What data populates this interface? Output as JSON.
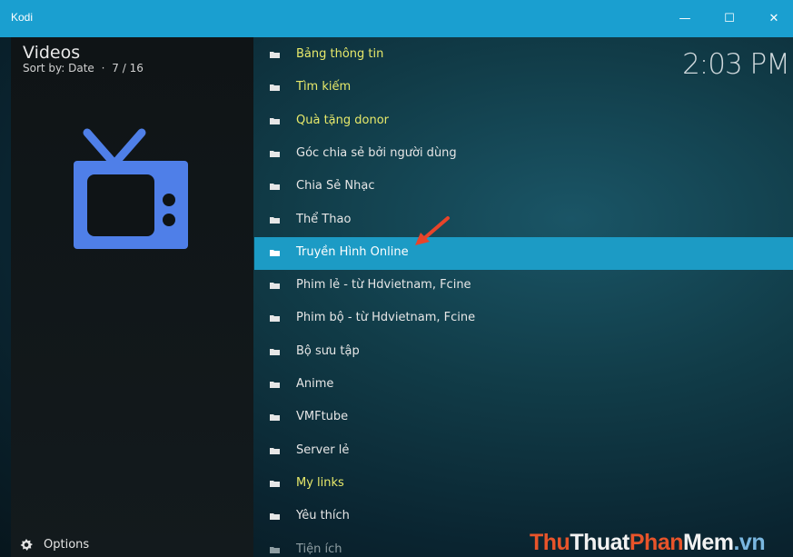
{
  "window": {
    "title": "Kodi",
    "min_glyph": "—",
    "max_glyph": "☐",
    "close_glyph": "✕"
  },
  "header": {
    "title": "Videos",
    "sort_text": "Sort by: Date",
    "separator": "·",
    "position": "7 / 16"
  },
  "clock": "2:03 PM",
  "list": {
    "items": [
      {
        "label": "Bảng thông tin",
        "style": "highlight",
        "icon": "folder-icon"
      },
      {
        "label": "Tìm kiếm",
        "style": "highlight",
        "icon": "folder-icon"
      },
      {
        "label": "Quà tặng donor",
        "style": "highlight",
        "icon": "folder-icon"
      },
      {
        "label": "Góc chia sẻ bởi người dùng",
        "style": "normal",
        "icon": "folder-icon"
      },
      {
        "label": "Chia Sẻ Nhạc",
        "style": "normal",
        "icon": "folder-icon"
      },
      {
        "label": "Thể Thao",
        "style": "normal",
        "icon": "folder-icon"
      },
      {
        "label": "Truyền Hình Online",
        "style": "selected",
        "icon": "folder-icon"
      },
      {
        "label": "Phim lẻ - từ Hdvietnam, Fcine",
        "style": "normal",
        "icon": "folder-icon"
      },
      {
        "label": "Phim bộ - từ Hdvietnam, Fcine",
        "style": "normal",
        "icon": "folder-icon"
      },
      {
        "label": "Bộ sưu tập",
        "style": "normal",
        "icon": "folder-icon"
      },
      {
        "label": "Anime",
        "style": "normal",
        "icon": "folder-icon"
      },
      {
        "label": "VMFtube",
        "style": "normal",
        "icon": "folder-icon"
      },
      {
        "label": "Server lẻ",
        "style": "normal",
        "icon": "folder-icon"
      },
      {
        "label": "My links",
        "style": "highlight",
        "icon": "folder-icon"
      },
      {
        "label": "Yêu thích",
        "style": "normal",
        "icon": "folder-icon"
      },
      {
        "label": "Tiện ích",
        "style": "dim",
        "icon": "folder-icon"
      }
    ]
  },
  "footer": {
    "options_label": "Options",
    "options_icon": "gear-icon"
  },
  "watermark": {
    "part1": "Thu",
    "part2": "Thuat",
    "part3": "Phan",
    "part4": "Mem",
    "part5": ".vn"
  },
  "colors": {
    "titlebar": "#1a9fd0",
    "selected_row": "#1c9bc5",
    "highlight_text": "#e7e96a",
    "tv_icon": "#4f7fe8",
    "arrow": "#e8442a"
  }
}
